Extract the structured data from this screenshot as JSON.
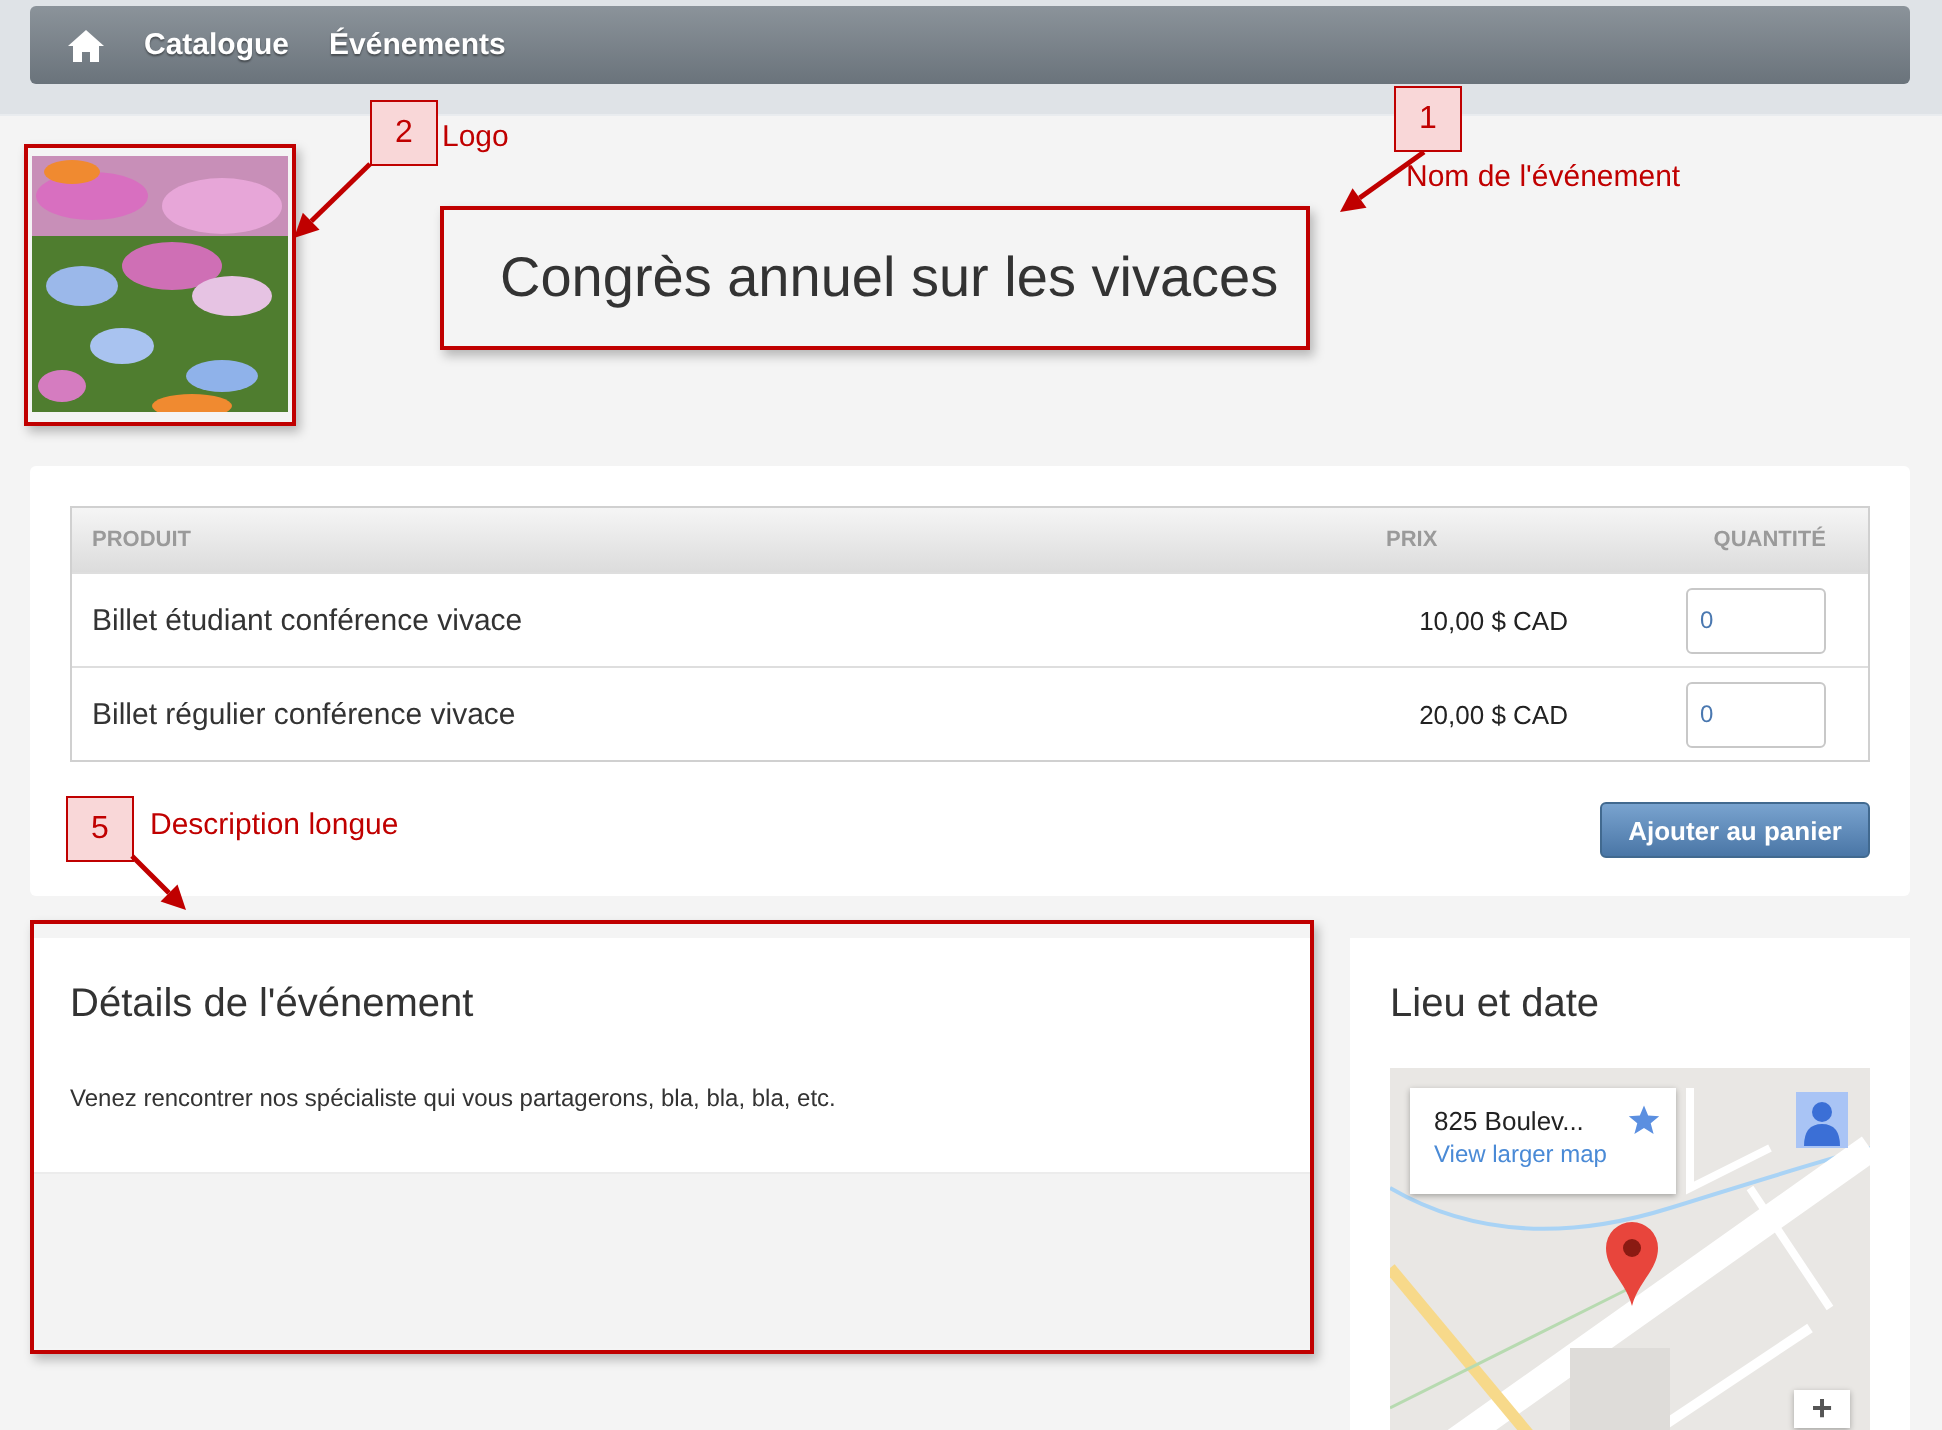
{
  "nav": {
    "items": [
      {
        "label": "Catalogue"
      },
      {
        "label": "Événements"
      }
    ]
  },
  "event": {
    "title": "Congrès annuel sur les vivaces"
  },
  "tickets": {
    "columns": [
      "PRODUIT",
      "PRIX",
      "QUANTITÉ"
    ],
    "rows": [
      {
        "product": "Billet étudiant conférence vivace",
        "price": "10,00 $ CAD",
        "quantity": "0"
      },
      {
        "product": "Billet régulier conférence vivace",
        "price": "20,00 $ CAD",
        "quantity": "0"
      }
    ],
    "button": "Ajouter au panier"
  },
  "details": {
    "title": "Détails de l'événement",
    "text": "Venez rencontrer nos spécialiste qui vous partagerons, bla, bla, bla, etc."
  },
  "location": {
    "title": "Lieu et date",
    "map": {
      "kind": "picture",
      "card_title": "825 Boulev...",
      "card_link": "View larger map",
      "zoom_button": "+"
    }
  },
  "annotations": [
    {
      "number": "2",
      "label": "Logo"
    },
    {
      "number": "1",
      "label": "Nom de l'événement"
    },
    {
      "number": "5",
      "label": "Description longue"
    }
  ]
}
